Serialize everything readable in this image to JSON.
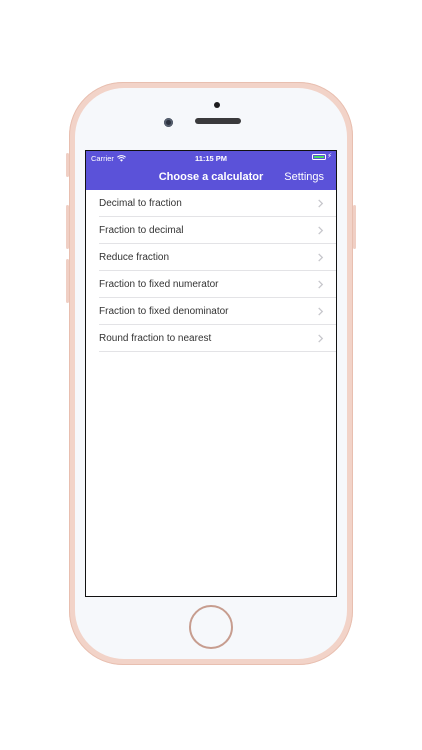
{
  "status_bar": {
    "carrier": "Carrier",
    "time": "11:15 PM"
  },
  "nav": {
    "title": "Choose a calculator",
    "right_button": "Settings"
  },
  "calculators": [
    {
      "label": "Decimal to fraction"
    },
    {
      "label": "Fraction to decimal"
    },
    {
      "label": "Reduce fraction"
    },
    {
      "label": "Fraction to fixed numerator"
    },
    {
      "label": "Fraction to fixed denominator"
    },
    {
      "label": "Round fraction to nearest"
    }
  ],
  "colors": {
    "nav_bar": "#5b52d9",
    "battery": "#4cd964",
    "phone_frame": "#f2d3c8"
  },
  "icons": [
    "wifi-icon",
    "battery-icon",
    "charging-bolt-icon",
    "chevron-right-icon"
  ]
}
